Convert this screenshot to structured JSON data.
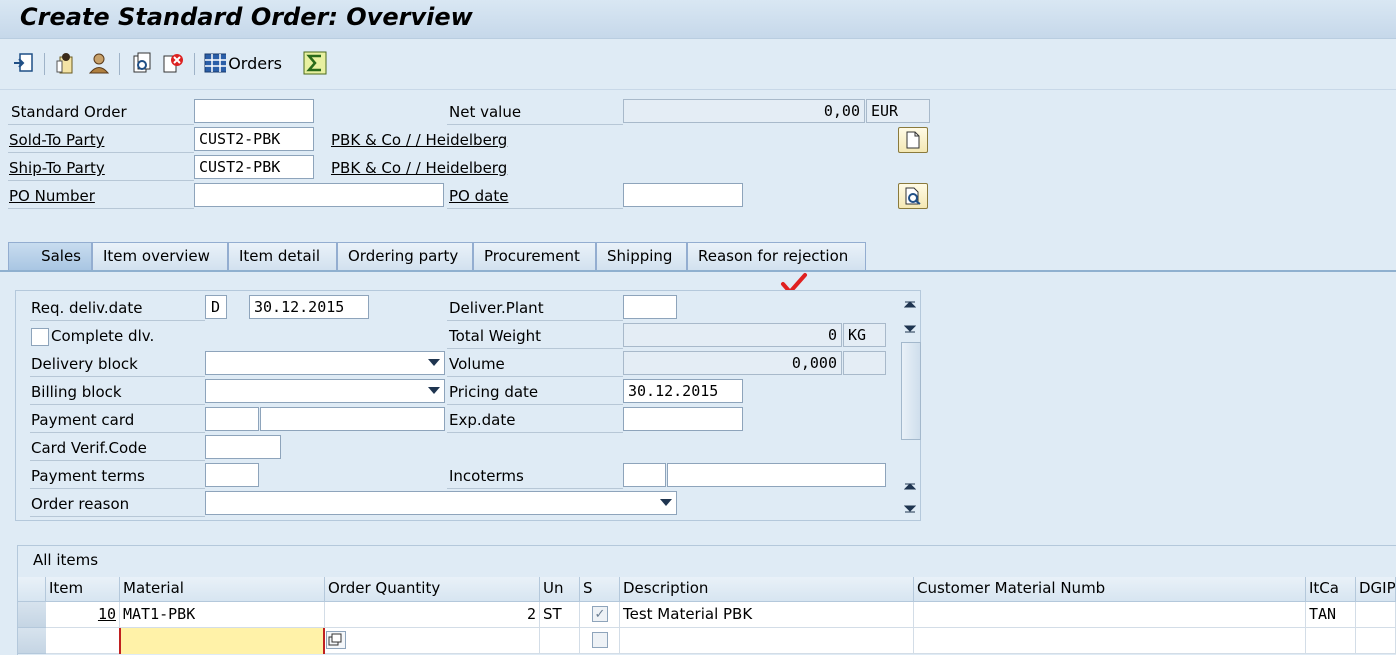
{
  "title": "Create Standard Order: Overview",
  "toolbar": {
    "orders_label": "Orders",
    "icons": [
      "enter-icon",
      "header-details-icon",
      "business-partner-icon",
      "display-doc-icon",
      "cancel-doc-icon",
      "orders-grid-icon",
      "sum-icon"
    ]
  },
  "header": {
    "standard_order_label": "Standard Order",
    "standard_order_value": "",
    "net_value_label": "Net value",
    "net_value": "0,00",
    "currency": "EUR",
    "sold_to_label": "Sold-To Party",
    "sold_to_value": "CUST2-PBK",
    "sold_to_desc": "PBK & Co / / Heidelberg",
    "ship_to_label": "Ship-To Party",
    "ship_to_value": "CUST2-PBK",
    "ship_to_desc": "PBK & Co / / Heidelberg",
    "po_number_label": "PO Number",
    "po_number_value": "",
    "po_date_label": "PO date",
    "po_date_value": ""
  },
  "tabs": [
    {
      "label": "Sales",
      "active": true
    },
    {
      "label": "Item overview"
    },
    {
      "label": "Item detail"
    },
    {
      "label": "Ordering party"
    },
    {
      "label": "Procurement"
    },
    {
      "label": "Shipping"
    },
    {
      "label": "Reason for rejection"
    }
  ],
  "sales": {
    "req_deliv_date_label": "Req. deliv.date",
    "req_deliv_date_type": "D",
    "req_deliv_date": "30.12.2015",
    "deliver_plant_label": "Deliver.Plant",
    "deliver_plant_value": "",
    "complete_dlv_label": "Complete dlv.",
    "total_weight_label": "Total Weight",
    "total_weight": "0",
    "weight_unit": "KG",
    "delivery_block_label": "Delivery block",
    "volume_label": "Volume",
    "volume": "0,000",
    "volume_unit": "",
    "billing_block_label": "Billing block",
    "pricing_date_label": "Pricing date",
    "pricing_date": "30.12.2015",
    "payment_card_label": "Payment card",
    "exp_date_label": "Exp.date",
    "card_verif_label": "Card Verif.Code",
    "payment_terms_label": "Payment terms",
    "incoterms_label": "Incoterms",
    "order_reason_label": "Order reason"
  },
  "items": {
    "title": "All items",
    "columns": [
      "Item",
      "Material",
      "Order Quantity",
      "Un",
      "S",
      "Description",
      "Customer Material Numb",
      "ItCa",
      "DGIP"
    ],
    "rows": [
      {
        "item": "10",
        "material": "MAT1-PBK",
        "quantity": "2",
        "unit": "ST",
        "description": "Test Material PBK",
        "customer_material": "",
        "itca": "TAN"
      }
    ]
  },
  "colors": {
    "background": "#dfebf5",
    "accent_check": "#e02020",
    "input_highlight": "#fff2a8"
  }
}
